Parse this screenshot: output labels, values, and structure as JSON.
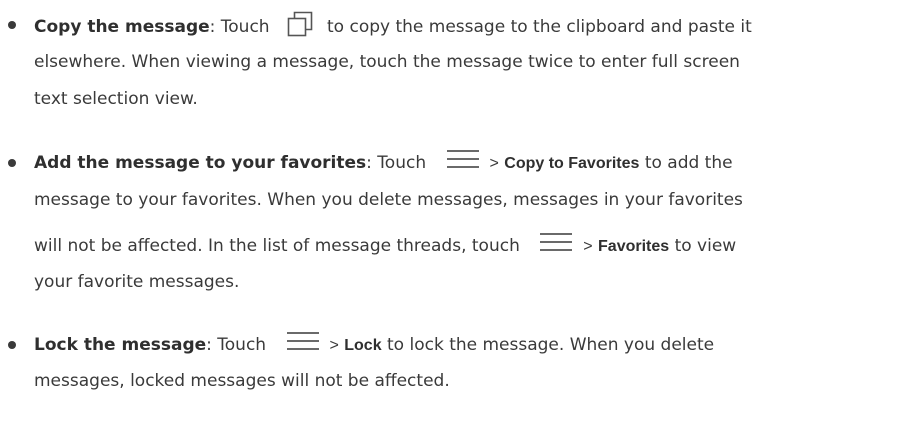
{
  "items": [
    {
      "heading": "Copy the message",
      "lines": [
        {
          "pre": ": Touch",
          "post": "to copy the message to the clipboard and paste it"
        },
        "elsewhere. When viewing a message, touch the message twice to enter full screen",
        "text selection view."
      ],
      "icon": "copy-icon"
    },
    {
      "heading": "Add the message to your favorites",
      "line1": {
        "pre": ": Touch",
        "sep": ">",
        "action": "Copy to Favorites",
        "post": "to add the"
      },
      "line2": "message to your favorites. When you delete messages, messages in your favorites",
      "line3": {
        "pre": "will not be affected. In the list of message threads, touch",
        "sep": ">",
        "action": "Favorites",
        "post": "to view"
      },
      "line4": "your favorite messages.",
      "icon": "menu-icon"
    },
    {
      "heading": "Lock the message",
      "line1": {
        "pre": ": Touch",
        "sep": ">",
        "action": "Lock",
        "post": "to lock the message. When you delete"
      },
      "line2": "messages, locked messages will not be affected.",
      "icon": "menu-icon"
    }
  ],
  "colors": {
    "text": "#3a3a3a",
    "icon_stroke": "#555555"
  }
}
